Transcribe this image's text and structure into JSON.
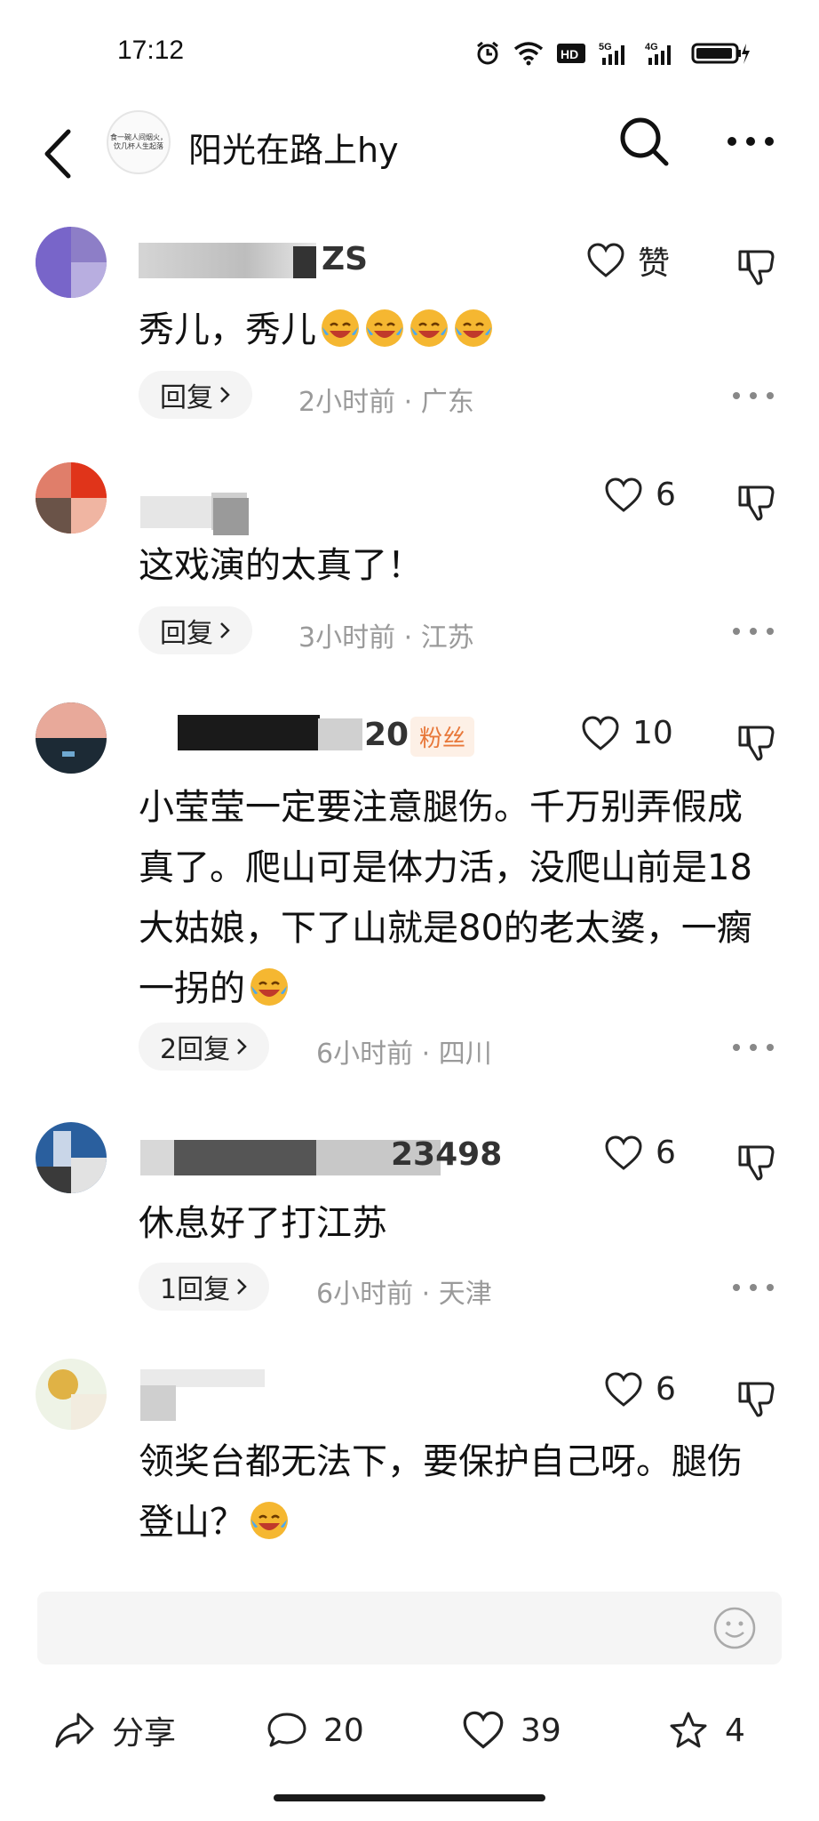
{
  "status_bar": {
    "time": "17:12",
    "icons": [
      "alarm-icon",
      "wifi-icon",
      "hd-icon",
      "signal-5g-icon",
      "signal-4g-icon",
      "battery-icon"
    ]
  },
  "header": {
    "title": "阳光在路上hy",
    "avatar_caption": "食一碗人间烟火，饮几杯人生起落"
  },
  "comments": [
    {
      "username": "ZS",
      "text": "秀儿，秀儿",
      "like_label": "赞",
      "reply_label": "回复",
      "meta": "2小时前 · 广东"
    },
    {
      "username": "",
      "text": "这戏演的太真了！",
      "like_count": "6",
      "reply_label": "回复",
      "meta": "3小时前 · 江苏"
    },
    {
      "username": "20",
      "badge": "粉丝",
      "text": "小莹莹一定要注意腿伤。千万别弄假成真了。爬山可是体力活，没爬山前是18大姑娘，下了山就是80的老太婆，一瘸一拐的",
      "like_count": "10",
      "reply_label": "2回复",
      "meta": "6小时前 · 四川"
    },
    {
      "username": "23498",
      "text": "休息好了打江苏",
      "like_count": "6",
      "reply_label": "1回复",
      "meta": "6小时前 · 天津"
    },
    {
      "username": "",
      "text": "领奖台都无法下，要保护自己呀。腿伤登山？",
      "like_count": "6",
      "reply_label": "",
      "meta": ""
    }
  ],
  "bottom_bar": {
    "share_label": "分享",
    "comment_count": "20",
    "like_count": "39",
    "favorite_count": "4"
  },
  "colors": {
    "badge_text": "#e8783a",
    "badge_bg": "#fdf0e6",
    "meta_text": "#9a9a9a",
    "pill_bg": "#f4f4f4"
  }
}
